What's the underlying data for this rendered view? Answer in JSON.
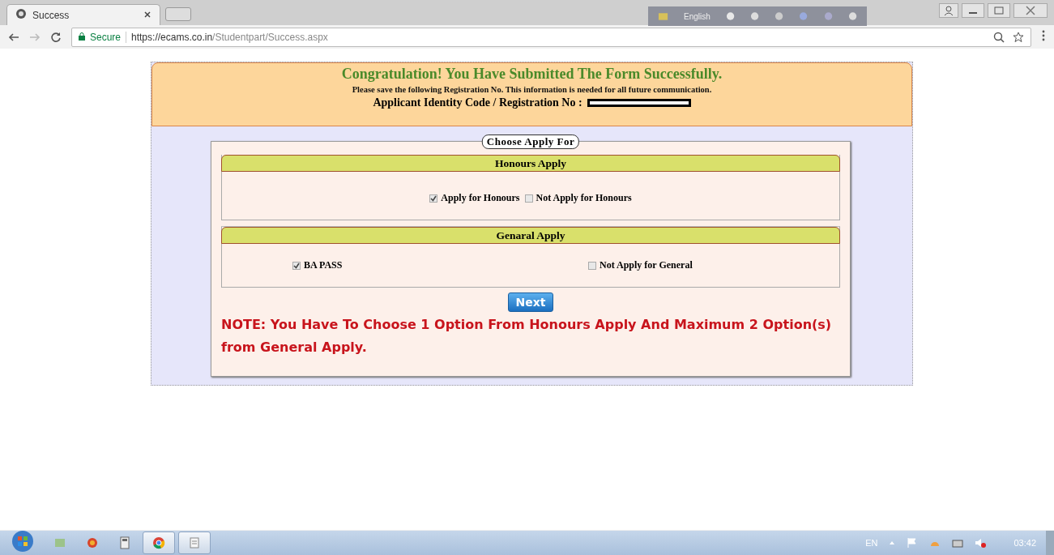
{
  "browser": {
    "tab_title": "Success",
    "secure_label": "Secure",
    "url_host": "https://ecams.co.in",
    "url_path": "/Studentpart/Success.aspx",
    "language_bar_label": "English"
  },
  "banner": {
    "title": "Congratulation! You Have Submitted The Form Successfully.",
    "instruction": "Please save the following Registration No. This information is needed for all future communication.",
    "registration_label": "Applicant Identity Code / Registration No :"
  },
  "form": {
    "legend": "Choose Apply For",
    "sections": [
      {
        "title": "Honours Apply",
        "kind": "inline",
        "options": [
          {
            "label": "Apply for Honours",
            "checked": true
          },
          {
            "label": "Not Apply for Honours",
            "checked": false
          }
        ]
      },
      {
        "title": "Genaral Apply",
        "kind": "spread",
        "options": [
          {
            "label": "BA PASS",
            "checked": true
          },
          {
            "label": "Not Apply for General",
            "checked": false
          }
        ]
      }
    ],
    "next_button": "Next",
    "note": "NOTE: You Have To Choose 1 Option From Honours Apply And Maximum 2 Option(s) from General Apply."
  },
  "taskbar": {
    "apps": [
      {
        "kind": "explorer",
        "running": false
      },
      {
        "kind": "media",
        "running": false
      },
      {
        "kind": "calculator",
        "running": false
      },
      {
        "kind": "chrome",
        "running": true
      },
      {
        "kind": "notepad",
        "running": true
      }
    ],
    "language": "EN",
    "clock": "03:42"
  }
}
